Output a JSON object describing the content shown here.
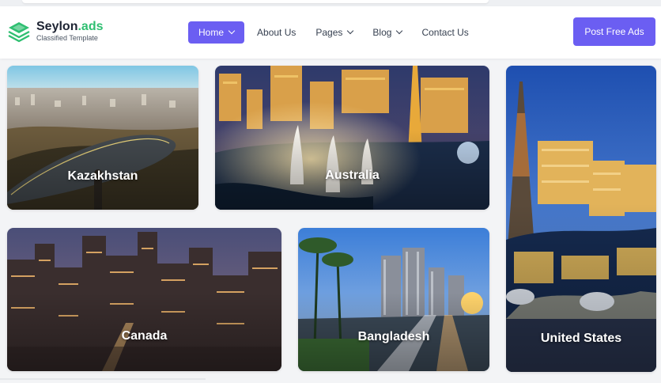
{
  "header": {
    "brand_main": "Seylon",
    "brand_dot": ".ads",
    "tagline": "Classified Template",
    "post_button": "Post Free Ads"
  },
  "nav": {
    "items": [
      {
        "label": "Home",
        "active": true,
        "dropdown": true
      },
      {
        "label": "About Us",
        "active": false,
        "dropdown": false
      },
      {
        "label": "Pages",
        "active": false,
        "dropdown": true
      },
      {
        "label": "Blog",
        "active": false,
        "dropdown": true
      },
      {
        "label": "Contact Us",
        "active": false,
        "dropdown": false
      }
    ]
  },
  "locations": [
    {
      "name": "Kazakhstan"
    },
    {
      "name": "Australia"
    },
    {
      "name": "United States"
    },
    {
      "name": "Canada"
    },
    {
      "name": "Bangladesh"
    }
  ],
  "colors": {
    "accent": "#6b5ef2",
    "logo_green": "#2fbf71",
    "brand_text": "#1e2433"
  },
  "icons": {
    "logo": "stacked-layers-icon",
    "nav_caret": "chevron-down-icon"
  }
}
